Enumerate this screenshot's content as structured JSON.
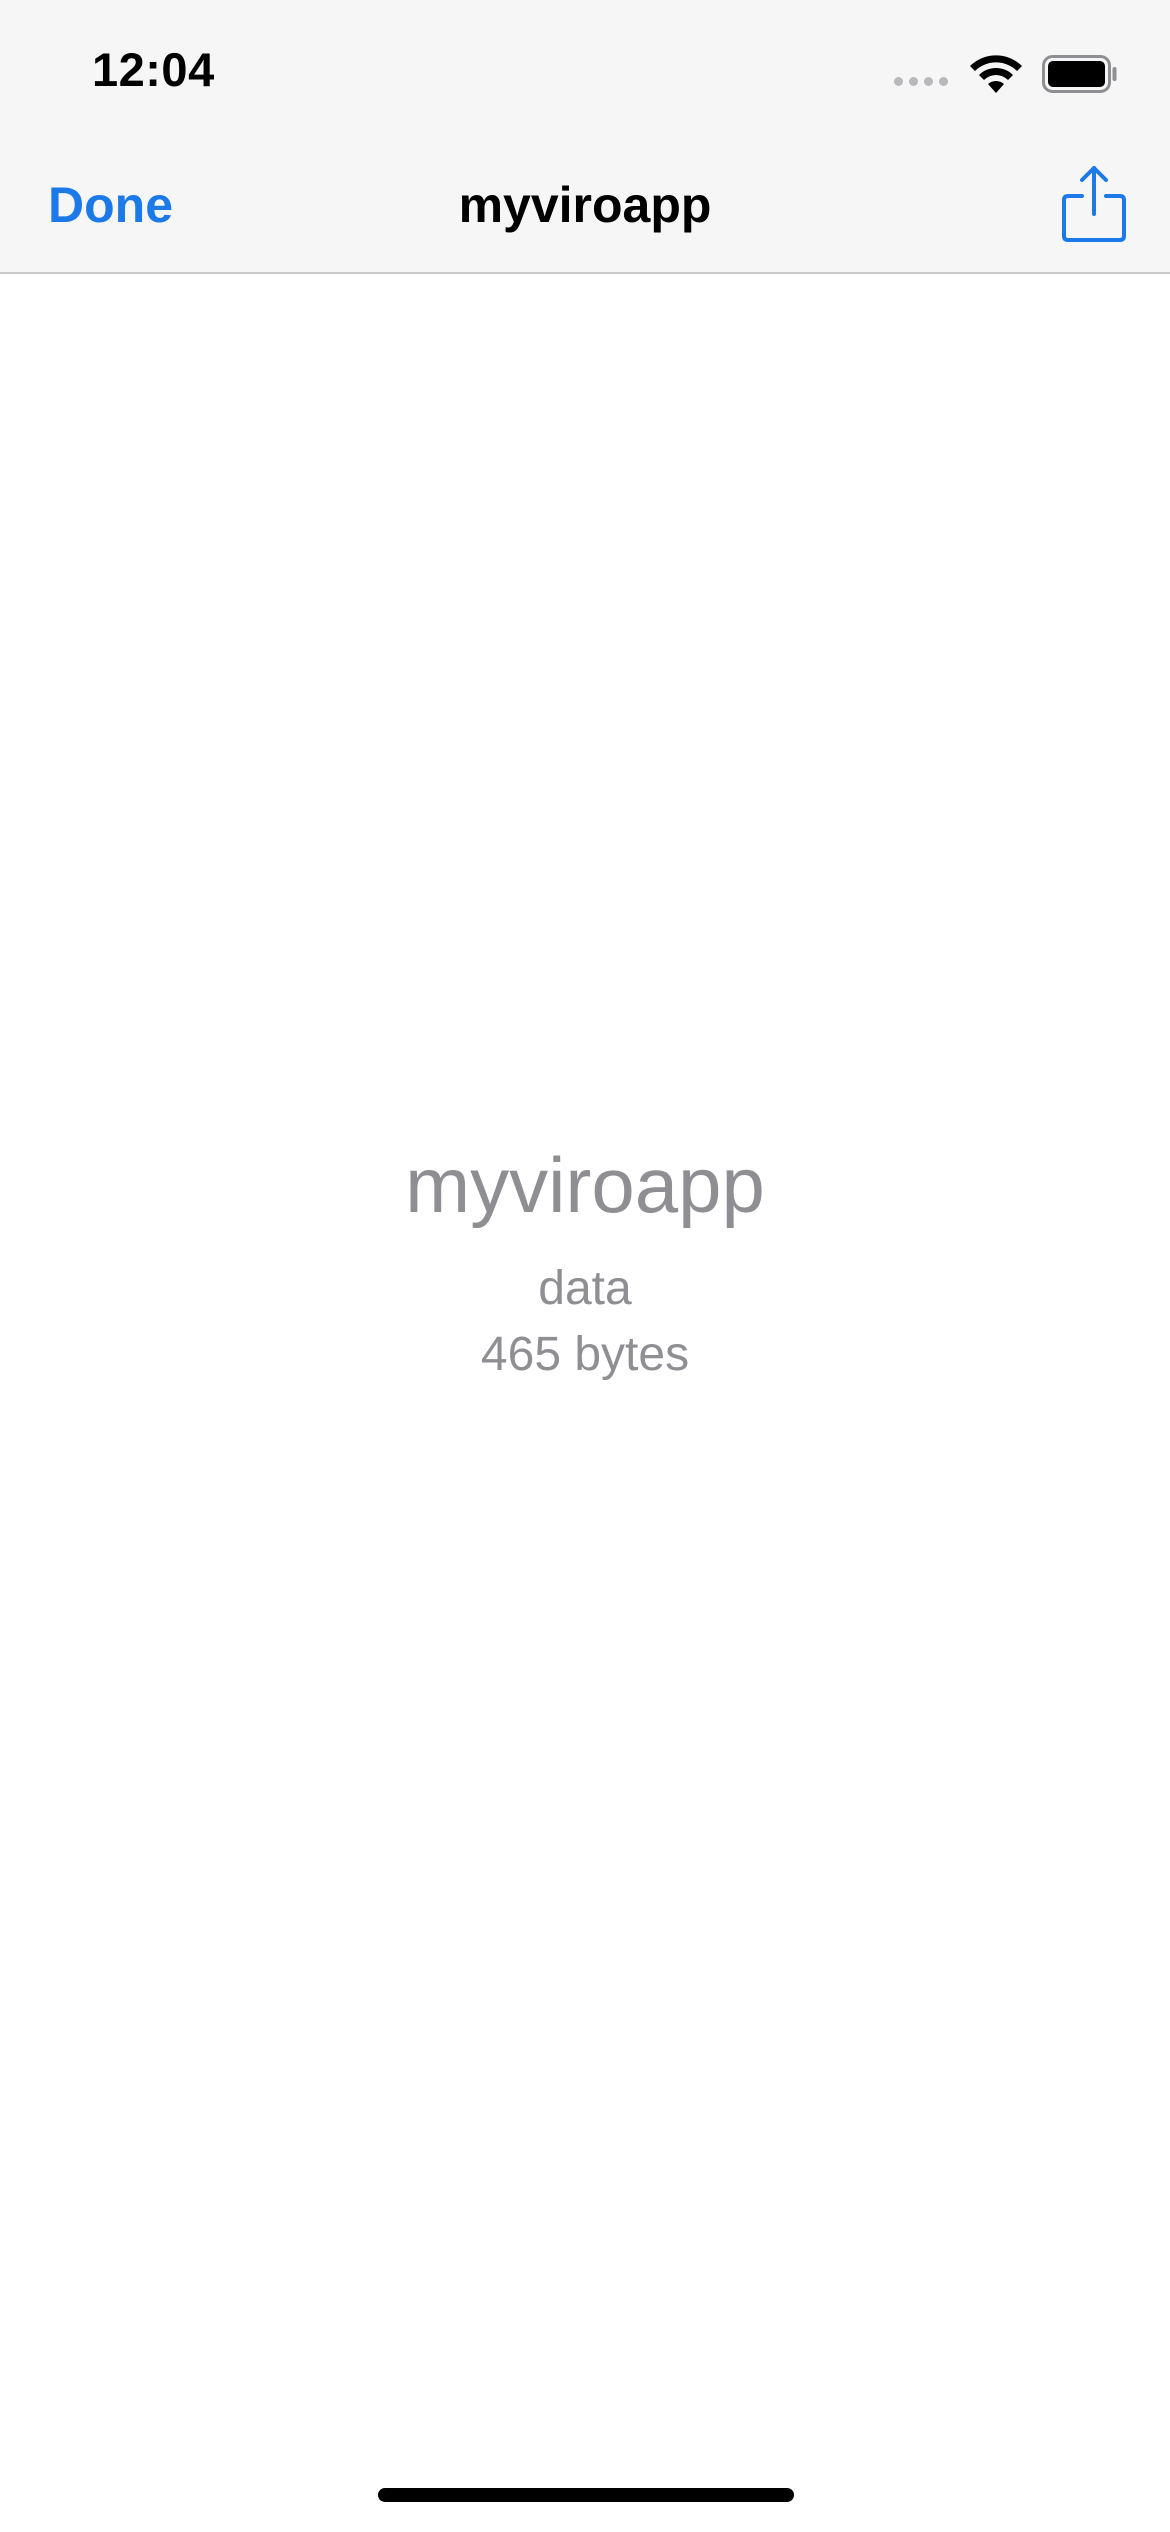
{
  "status_bar": {
    "time": "12:04",
    "icons": [
      "cellular-signal-icon",
      "wifi-icon",
      "battery-icon"
    ]
  },
  "nav_bar": {
    "done_label": "Done",
    "title": "myviroapp",
    "share_icon": "share-icon"
  },
  "file_preview": {
    "name": "myviroapp",
    "type": "data",
    "size": "465 bytes"
  },
  "colors": {
    "accent": "#1c7ae8",
    "secondary_text": "#8e8e93",
    "bar_background": "#f6f6f6"
  }
}
